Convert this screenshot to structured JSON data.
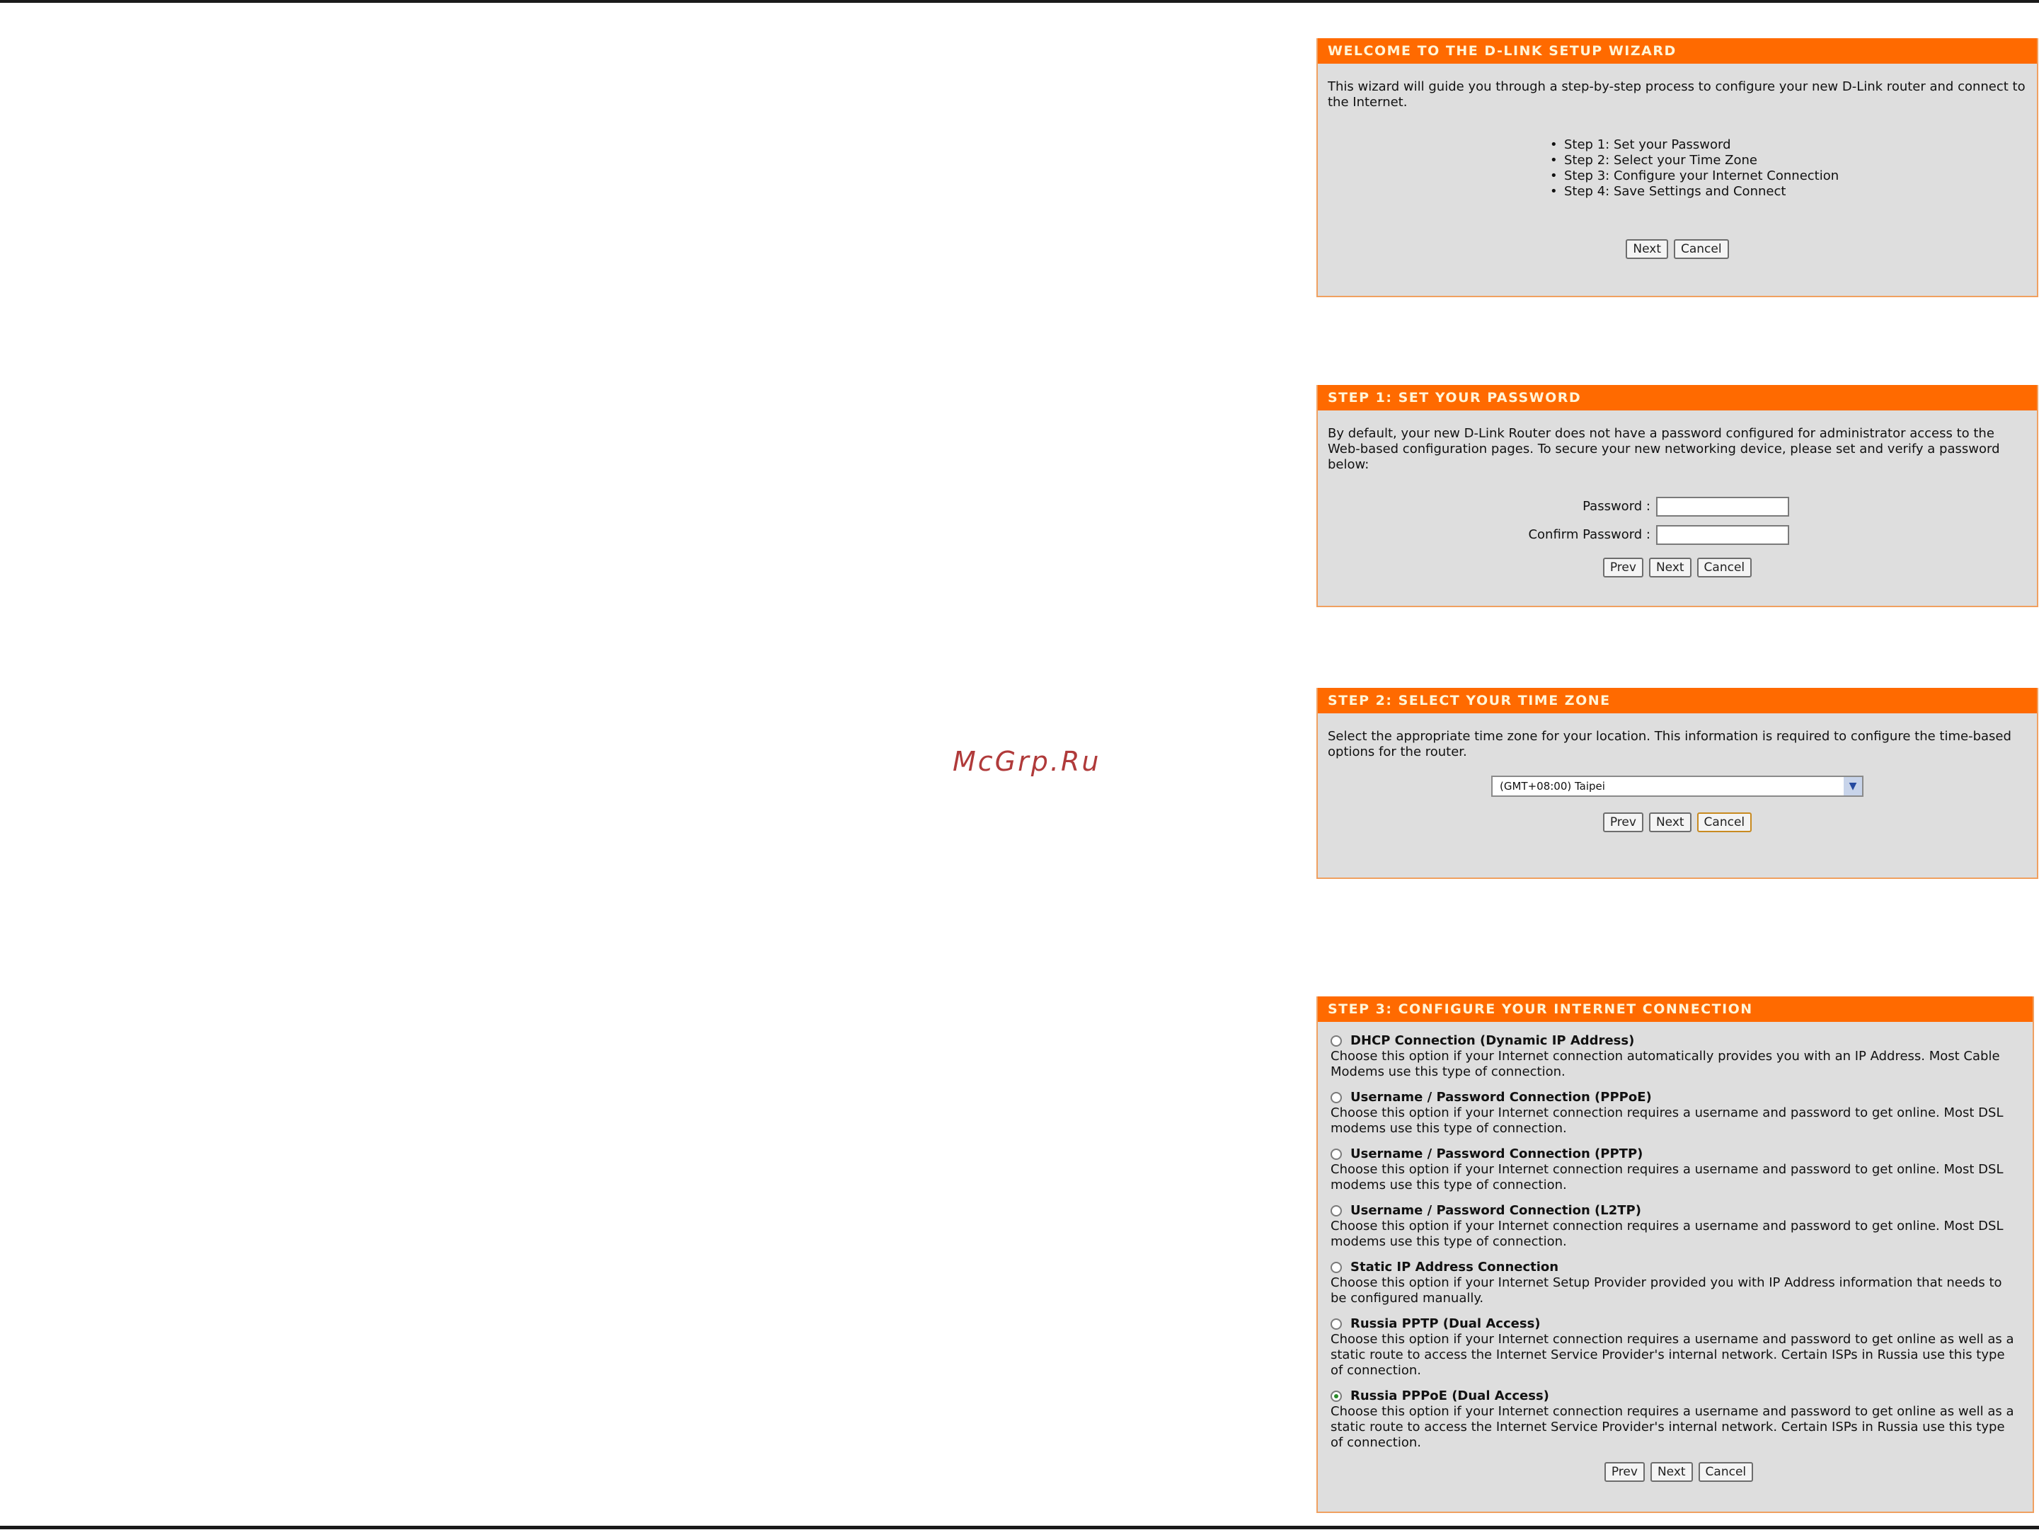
{
  "watermark": "McGrp.Ru",
  "welcome": {
    "title": "WELCOME TO THE D-LINK SETUP WIZARD",
    "description": "This wizard will guide you through a step-by-step process to configure your new D-Link router and connect to the Internet.",
    "steps": [
      "Step 1: Set your Password",
      "Step 2: Select your Time Zone",
      "Step 3: Configure your Internet Connection",
      "Step 4: Save Settings and Connect"
    ],
    "next_label": "Next",
    "cancel_label": "Cancel"
  },
  "step1": {
    "title": "STEP 1: SET YOUR PASSWORD",
    "description": "By default, your new D-Link Router does not have a password configured for administrator access to the Web-based configuration pages. To secure your new networking device, please set and verify a password below:",
    "password_label": "Password :",
    "password_value": "",
    "confirm_label": "Confirm Password :",
    "confirm_value": "",
    "prev_label": "Prev",
    "next_label": "Next",
    "cancel_label": "Cancel"
  },
  "step2": {
    "title": "STEP 2: SELECT YOUR TIME ZONE",
    "description": "Select the appropriate time zone for your location. This information is required to configure the time-based options for the router.",
    "timezone_value": "(GMT+08:00) Taipei",
    "prev_label": "Prev",
    "next_label": "Next",
    "cancel_label": "Cancel"
  },
  "step3": {
    "title": "STEP 3: CONFIGURE YOUR INTERNET CONNECTION",
    "options": [
      {
        "label": "DHCP Connection (Dynamic IP Address)",
        "text": "Choose this option if your Internet connection automatically provides you with an IP Address. Most Cable Modems use this type of connection.",
        "selected": false
      },
      {
        "label": "Username / Password Connection (PPPoE)",
        "text": "Choose this option if your Internet connection requires a username and password to get online. Most DSL modems use this type of connection.",
        "selected": false
      },
      {
        "label": "Username / Password Connection (PPTP)",
        "text": "Choose this option if your Internet connection requires a username and password to get online. Most DSL modems use this type of connection.",
        "selected": false
      },
      {
        "label": "Username / Password Connection (L2TP)",
        "text": "Choose this option if your Internet connection requires a username and password to get online. Most DSL modems use this type of connection.",
        "selected": false
      },
      {
        "label": "Static IP Address Connection",
        "text": "Choose this option if your Internet Setup Provider provided you with IP Address information that needs to be configured manually.",
        "selected": false
      },
      {
        "label": "Russia PPTP (Dual Access)",
        "text": "Choose this option if your Internet connection requires a username and password to get online as well as a static route to access the Internet Service Provider's internal network. Certain ISPs in Russia use this type of connection.",
        "selected": false
      },
      {
        "label": "Russia PPPoE (Dual Access)",
        "text": "Choose this option if your Internet connection requires a username and password to get online as well as a static route to access the Internet Service Provider's internal network. Certain ISPs in Russia use this type of connection.",
        "selected": true
      }
    ],
    "prev_label": "Prev",
    "next_label": "Next",
    "cancel_label": "Cancel"
  }
}
